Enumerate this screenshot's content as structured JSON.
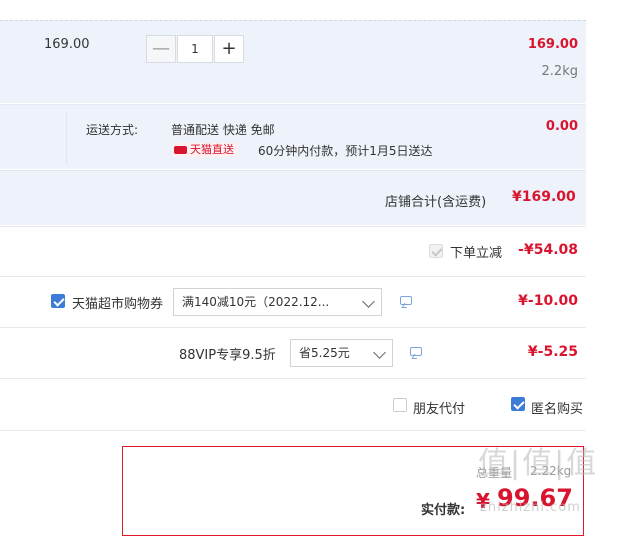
{
  "item": {
    "unit_price": "169.00",
    "quantity": "1",
    "minus_symbol": "—",
    "plus_symbol": "+",
    "line_total": "169.00",
    "weight": "2.2kg"
  },
  "shipping": {
    "label": "运送方式:",
    "method": "普通配送 快递 免邮",
    "badge": "天猫直送",
    "note": "60分钟内付款，预计1月5日送达",
    "fee": "0.00"
  },
  "subtotal": {
    "label": "店铺合计(含运费)",
    "value": "¥169.00"
  },
  "discounts": [
    {
      "label": "下单立减",
      "value": "-¥54.08",
      "checked": true,
      "disabled": true
    },
    {
      "label": "天猫超市购物券",
      "select": "满140减10元（2022.12...",
      "value": "¥-10.00",
      "checked": true
    },
    {
      "label": "88VIP专享9.5折",
      "select": "省5.25元",
      "value": "¥-5.25"
    }
  ],
  "options": {
    "friend_pay": "朋友代付",
    "anonymous": "匿名购买"
  },
  "summary": {
    "weight_label": "总重量",
    "weight_value": "2.22kg",
    "pay_label": "实付款:",
    "currency": "¥",
    "pay_value": "99.67"
  },
  "watermark": {
    "text": "值|值|值",
    "url": "zhizhizhi.com"
  },
  "colors": {
    "accent": "#d8142f",
    "row_bg": "#eef3fb",
    "checkbox": "#3d7bd9"
  }
}
